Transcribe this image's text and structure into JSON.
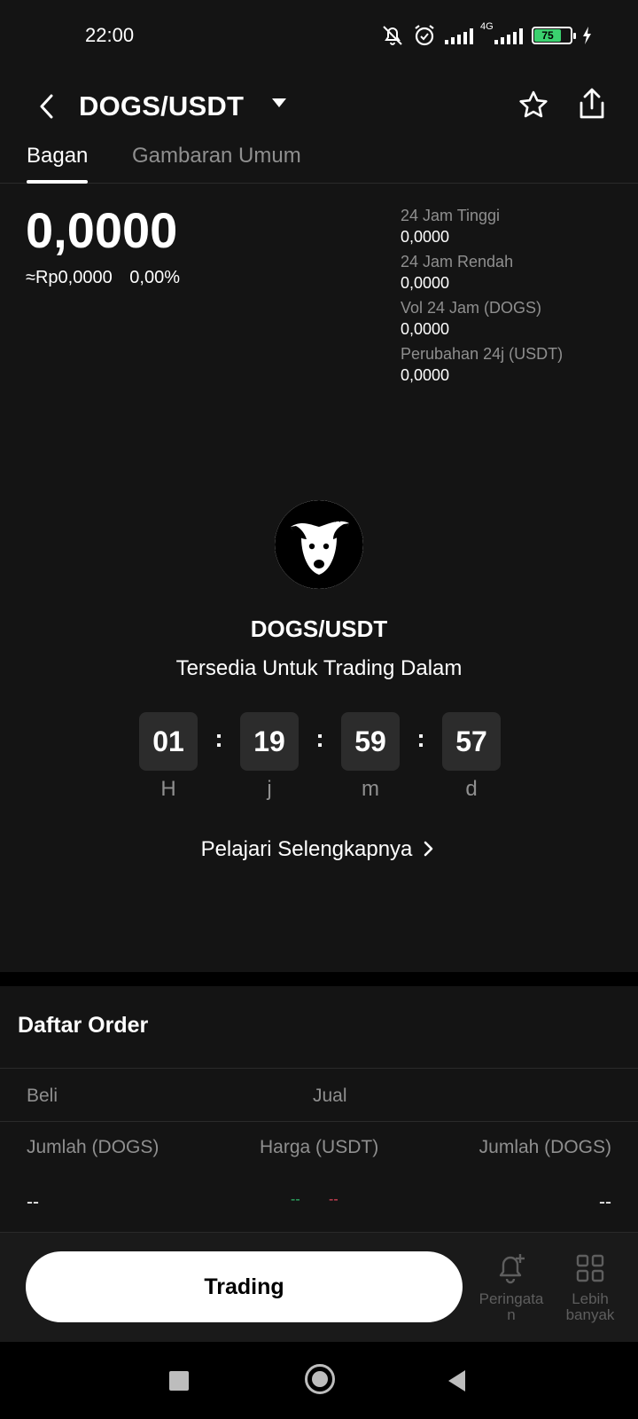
{
  "status_bar": {
    "time": "22:00",
    "network": "4G",
    "battery": "75"
  },
  "header": {
    "pair": "DOGS/USDT",
    "icons": [
      "back-icon",
      "dropdown-caret-icon",
      "star-icon",
      "share-icon"
    ]
  },
  "tabs": [
    {
      "label": "Bagan",
      "active": true
    },
    {
      "label": "Gambaran Umum",
      "active": false
    }
  ],
  "price": {
    "last": "0,0000",
    "fiat": "≈Rp0,0000",
    "change": "0,00%"
  },
  "stats": [
    {
      "label": "24 Jam Tinggi",
      "value": "0,0000"
    },
    {
      "label": "24 Jam Rendah",
      "value": "0,0000"
    },
    {
      "label": "Vol 24 Jam (DOGS)",
      "value": "0,0000"
    },
    {
      "label": "Perubahan 24j (USDT)",
      "value": "0,0000"
    }
  ],
  "listing": {
    "title": "DOGS/USDT",
    "subtitle": "Tersedia Untuk Trading Dalam",
    "countdown": [
      {
        "value": "01",
        "unit": "H"
      },
      {
        "value": "19",
        "unit": "j"
      },
      {
        "value": "59",
        "unit": "m"
      },
      {
        "value": "57",
        "unit": "d"
      }
    ],
    "separator": ":",
    "learn_more": "Pelajari Selengkapnya"
  },
  "order_book": {
    "title": "Daftar Order",
    "buy_tab": "Beli",
    "sell_tab": "Jual",
    "columns": [
      "Jumlah (DOGS)",
      "Harga (USDT)",
      "Jumlah (DOGS)"
    ],
    "row": {
      "left": "--",
      "mid_buy": "--",
      "mid_sell": "--",
      "right": "--"
    },
    "colors": {
      "buy": "#2fb96b",
      "sell": "#e0455b"
    }
  },
  "action_bar": {
    "trade_label": "Trading",
    "alert_label_line1": "Peringata",
    "alert_label_line2": "n",
    "more_label_line1": "Lebih",
    "more_label_line2": "banyak"
  }
}
